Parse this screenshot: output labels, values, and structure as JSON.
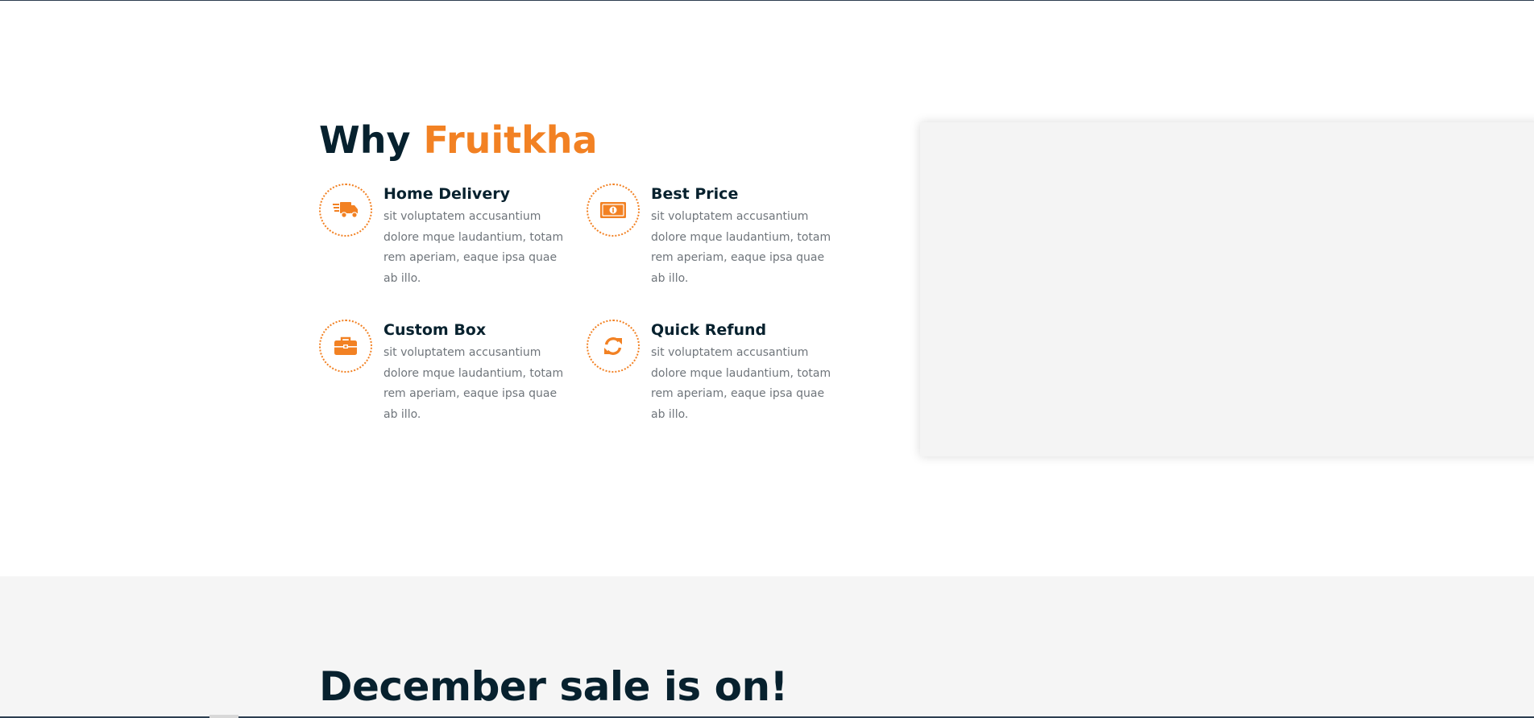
{
  "colors": {
    "accent": "#F28123",
    "heading": "#07212e",
    "body_text": "#6f757b",
    "panel": "#f4f4f4",
    "sale_background": "#f5f5f5"
  },
  "why": {
    "title_prefix": "Why",
    "title_brand": "Fruitkha",
    "features": [
      {
        "icon": "truck-icon",
        "title": "Home Delivery",
        "text": "sit voluptatem accusantium dolore mque laudantium, totam rem aperiam, eaque ipsa quae ab illo."
      },
      {
        "icon": "money-icon",
        "title": "Best Price",
        "text": "sit voluptatem accusantium dolore mque laudantium, totam rem aperiam, eaque ipsa quae ab illo."
      },
      {
        "icon": "briefcase-icon",
        "title": "Custom Box",
        "text": "sit voluptatem accusantium dolore mque laudantium, totam rem aperiam, eaque ipsa quae ab illo."
      },
      {
        "icon": "sync-icon",
        "title": "Quick Refund",
        "text": "sit voluptatem accusantium dolore mque laudantium, totam rem aperiam, eaque ipsa quae ab illo."
      }
    ]
  },
  "sale": {
    "title": "December sale is on!"
  }
}
